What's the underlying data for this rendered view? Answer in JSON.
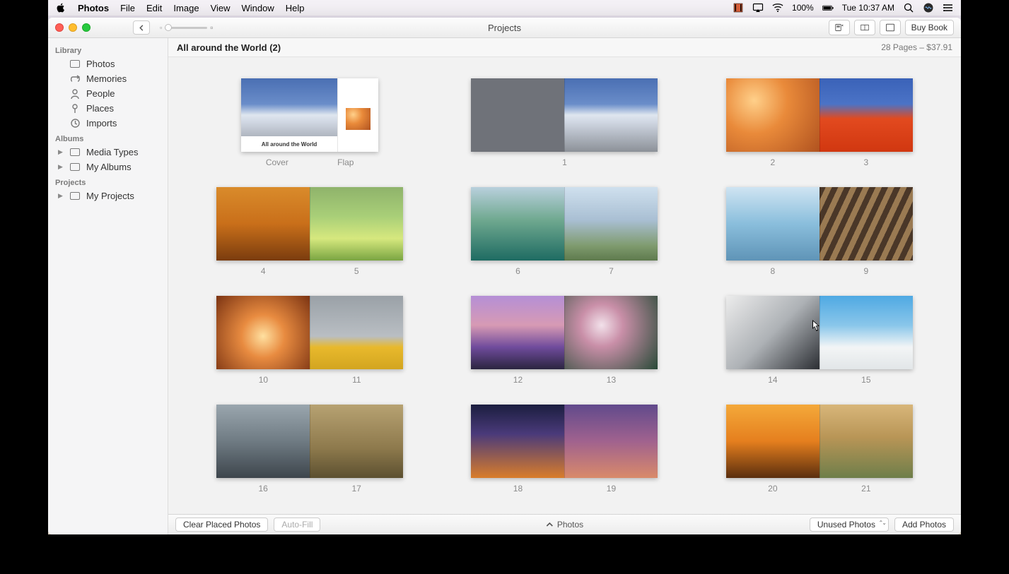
{
  "menubar": {
    "app": "Photos",
    "items": [
      "File",
      "Edit",
      "Image",
      "View",
      "Window",
      "Help"
    ],
    "battery_pct": "100%",
    "clock": "Tue 10:37 AM"
  },
  "toolbar": {
    "window_title": "Projects",
    "buy_button": "Buy Book"
  },
  "sidebar": {
    "sections": [
      {
        "header": "Library",
        "items": [
          {
            "label": "Photos",
            "glyph": "square"
          },
          {
            "label": "Memories",
            "glyph": "loop"
          },
          {
            "label": "People",
            "glyph": "person"
          },
          {
            "label": "Places",
            "glyph": "pin"
          },
          {
            "label": "Imports",
            "glyph": "clock"
          }
        ]
      },
      {
        "header": "Albums",
        "items": [
          {
            "label": "Media Types",
            "glyph": "square",
            "disclosure": true
          },
          {
            "label": "My Albums",
            "glyph": "square",
            "disclosure": true
          }
        ]
      },
      {
        "header": "Projects",
        "items": [
          {
            "label": "My Projects",
            "glyph": "square",
            "disclosure": true
          }
        ]
      }
    ]
  },
  "project": {
    "title": "All around the World (2)",
    "summary": "28 Pages – $37.91",
    "cover_caption": "All around the World",
    "spreads": [
      {
        "left_label": "Cover",
        "right_label": "Flap",
        "left_photo": "ph-mountain",
        "right_photo": "ph-canyon",
        "kind": "cover"
      },
      {
        "left_label": "",
        "right_label": "1",
        "left_photo": "ph-grey",
        "right_photo": "ph-mountain",
        "center_label": true
      },
      {
        "left_label": "2",
        "right_label": "3",
        "left_photo": "ph-canyon",
        "right_photo": "ph-tulips"
      },
      {
        "left_label": "4",
        "right_label": "5",
        "left_photo": "ph-forest",
        "right_photo": "ph-field"
      },
      {
        "left_label": "6",
        "right_label": "7",
        "left_photo": "ph-lake",
        "right_photo": "ph-houses"
      },
      {
        "left_label": "8",
        "right_label": "9",
        "left_photo": "ph-modern",
        "right_photo": "ph-slats"
      },
      {
        "left_label": "10",
        "right_label": "11",
        "left_photo": "ph-cave",
        "right_photo": "ph-taxis"
      },
      {
        "left_label": "12",
        "right_label": "13",
        "left_photo": "ph-sunset",
        "right_photo": "ph-blossom"
      },
      {
        "left_label": "14",
        "right_label": "15",
        "left_photo": "ph-geo",
        "right_photo": "ph-santor"
      },
      {
        "left_label": "16",
        "right_label": "17",
        "left_photo": "ph-mural",
        "right_photo": "ph-alley"
      },
      {
        "left_label": "18",
        "right_label": "19",
        "left_photo": "ph-bridge",
        "right_photo": "ph-cityn"
      },
      {
        "left_label": "20",
        "right_label": "21",
        "left_photo": "ph-orange",
        "right_photo": "ph-rural"
      }
    ]
  },
  "bottombar": {
    "clear": "Clear Placed Photos",
    "autofill": "Auto-Fill",
    "photos_toggle": "Photos",
    "filter": "Unused Photos",
    "add": "Add Photos"
  }
}
